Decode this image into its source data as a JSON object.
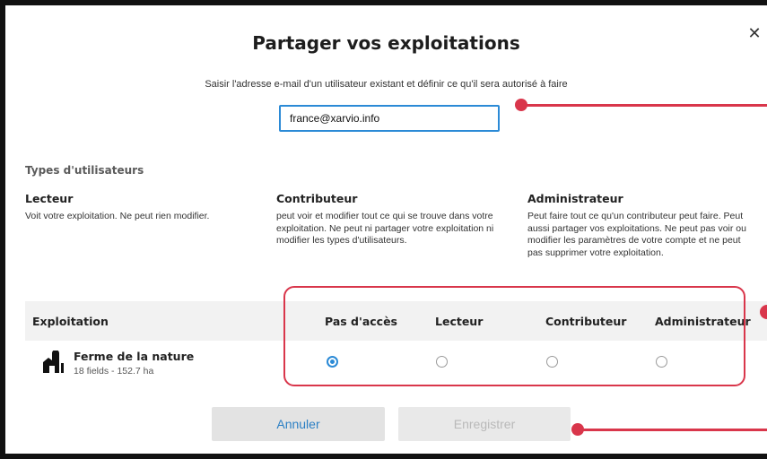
{
  "dialog": {
    "title": "Partager vos exploitations",
    "close_icon": "close-icon",
    "subtitle": "Saisir l'adresse e-mail d'un utilisateur existant et définir ce qu'il sera autorisé à faire",
    "email_value": "france@xarvio.info"
  },
  "user_types": {
    "section_label": "Types d'utilisateurs",
    "roles": [
      {
        "name": "Lecteur",
        "description": "Voit votre exploitation. Ne peut rien modifier."
      },
      {
        "name": "Contributeur",
        "description": "peut voir et modifier tout ce qui se trouve dans votre exploitation. Ne peut ni partager votre exploitation ni modifier les types d'utilisateurs."
      },
      {
        "name": "Administrateur",
        "description": "Peut faire tout ce qu'un contributeur peut faire. Peut aussi partager vos exploitations. Ne peut pas voir ou modifier les paramètres de votre compte et ne peut pas supprimer votre exploitation."
      }
    ]
  },
  "table": {
    "headers": [
      "Exploitation",
      "Pas d'accès",
      "Lecteur",
      "Contributeur",
      "Administrateur"
    ],
    "rows": [
      {
        "farm_icon": "farm-icon",
        "name": "Ferme de la nature",
        "meta": "18 fields - 152.7 ha",
        "selected": "Pas d'accès"
      }
    ]
  },
  "buttons": {
    "cancel": "Annuler",
    "save": "Enregistrer",
    "save_enabled": false
  },
  "colors": {
    "accent": "#2b8ad6",
    "annotation": "#d9364b",
    "header_bg": "#f2f2f2"
  }
}
